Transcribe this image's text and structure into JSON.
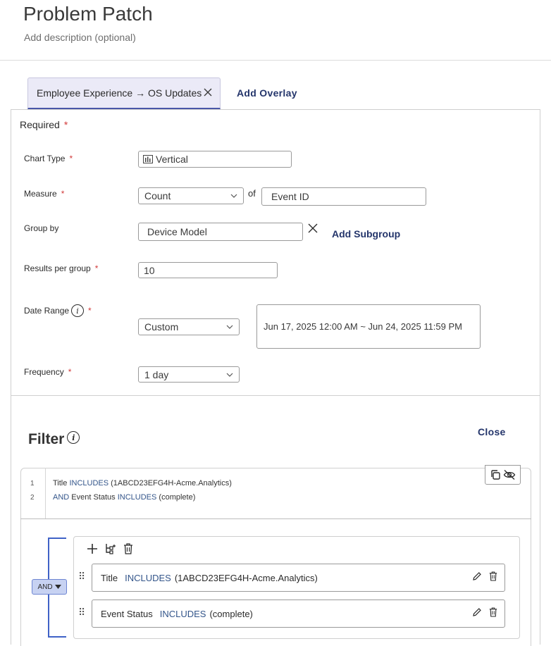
{
  "header": {
    "title": "Problem Patch",
    "description": "Add description (optional)"
  },
  "tabs": {
    "active_label": "Employee Experience → OS Updates",
    "add_overlay": "Add Overlay"
  },
  "required_section": {
    "title": "Required",
    "required_mark": "*"
  },
  "form": {
    "chart_type": {
      "label": "Chart Type",
      "value": "Vertical"
    },
    "measure": {
      "label": "Measure",
      "value": "Count",
      "of_text": "of",
      "field_value": "Event ID"
    },
    "group_by": {
      "label": "Group by",
      "value": "Device Model",
      "add_subgroup": "Add Subgroup"
    },
    "results_per_group": {
      "label": "Results per group",
      "value": "10"
    },
    "date_range": {
      "label": "Date Range",
      "info": "i",
      "value": "Custom",
      "range_text": "Jun 17, 2025 12:00 AM ~ Jun 24, 2025 11:59 PM"
    },
    "frequency": {
      "label": "Frequency",
      "value": "1 day"
    }
  },
  "filter": {
    "title": "Filter",
    "info": "i",
    "close": "Close",
    "code_lines": [
      {
        "num": "1",
        "prefix": "",
        "field": "Title",
        "op": "INCLUDES",
        "value": "(1ABCD23EFG4H-Acme.Analytics)"
      },
      {
        "num": "2",
        "prefix": "AND",
        "field": "Event Status",
        "op": "INCLUDES",
        "value": "(complete)"
      }
    ],
    "group_logic": "AND",
    "rules": [
      {
        "field": "Title",
        "op": "INCLUDES",
        "value": "(1ABCD23EFG4H-Acme.Analytics)"
      },
      {
        "field": "Event Status",
        "op": "INCLUDES",
        "value": "(complete)"
      }
    ]
  },
  "colors": {
    "accent_link": "#24356b",
    "required": "#d23a3a",
    "keyword": "#33558a",
    "bracket": "#3f62c7",
    "tab_bg": "#ebeaf7"
  }
}
